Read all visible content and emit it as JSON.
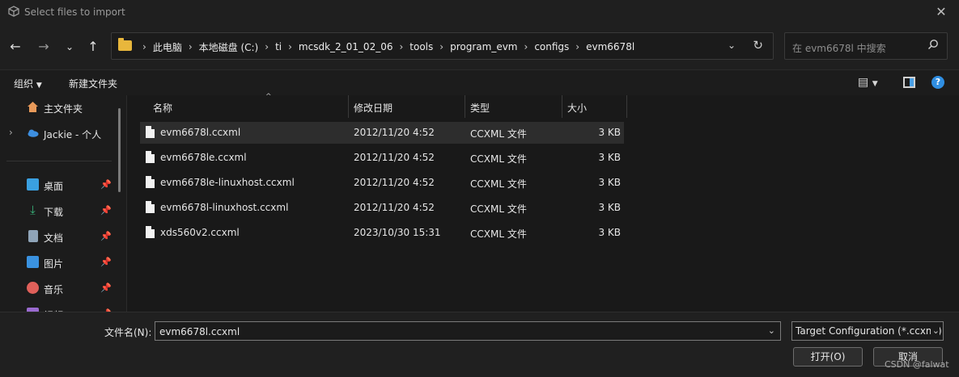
{
  "window": {
    "title": "Select files to import"
  },
  "address": {
    "crumbs": [
      "此电脑",
      "本地磁盘 (C:)",
      "ti",
      "mcsdk_2_01_02_06",
      "tools",
      "program_evm",
      "configs",
      "evm6678l"
    ]
  },
  "search": {
    "placeholder": "在 evm6678l 中搜索"
  },
  "toolbar": {
    "organize": "组织",
    "new_folder": "新建文件夹"
  },
  "sidebar": {
    "items": [
      {
        "label": "主文件夹",
        "icon": "home-icon",
        "color": "#e89a5a",
        "pinned": false
      },
      {
        "label": "Jackie - 个人",
        "icon": "cloud-icon",
        "color": "#3d8fe0",
        "pinned": false
      },
      {
        "label": "桌面",
        "icon": "desktop-icon",
        "color": "#3aa0e0",
        "pinned": true
      },
      {
        "label": "下载",
        "icon": "download-icon",
        "color": "#38b37a",
        "pinned": true
      },
      {
        "label": "文档",
        "icon": "document-icon",
        "color": "#8fa4b8",
        "pinned": true
      },
      {
        "label": "图片",
        "icon": "picture-icon",
        "color": "#3a92e0",
        "pinned": true
      },
      {
        "label": "音乐",
        "icon": "music-icon",
        "color": "#e0605a",
        "pinned": true
      },
      {
        "label": "视频",
        "icon": "video-icon",
        "color": "#9a6ad0",
        "pinned": true
      }
    ]
  },
  "columns": {
    "name": "名称",
    "date": "修改日期",
    "type": "类型",
    "size": "大小"
  },
  "files": [
    {
      "name": "evm6678l.ccxml",
      "date": "2012/11/20 4:52",
      "type": "CCXML 文件",
      "size": "3 KB"
    },
    {
      "name": "evm6678le.ccxml",
      "date": "2012/11/20 4:52",
      "type": "CCXML 文件",
      "size": "3 KB"
    },
    {
      "name": "evm6678le-linuxhost.ccxml",
      "date": "2012/11/20 4:52",
      "type": "CCXML 文件",
      "size": "3 KB"
    },
    {
      "name": "evm6678l-linuxhost.ccxml",
      "date": "2012/11/20 4:52",
      "type": "CCXML 文件",
      "size": "3 KB"
    },
    {
      "name": "xds560v2.ccxml",
      "date": "2023/10/30 15:31",
      "type": "CCXML 文件",
      "size": "3 KB"
    }
  ],
  "footer": {
    "filename_label": "文件名(N):",
    "filename_value": "evm6678l.ccxml",
    "filetype_value": "Target Configuration (*.ccxml)",
    "open_label": "打开(O)",
    "cancel_label": "取消",
    "watermark": "CSDN @falwat"
  }
}
